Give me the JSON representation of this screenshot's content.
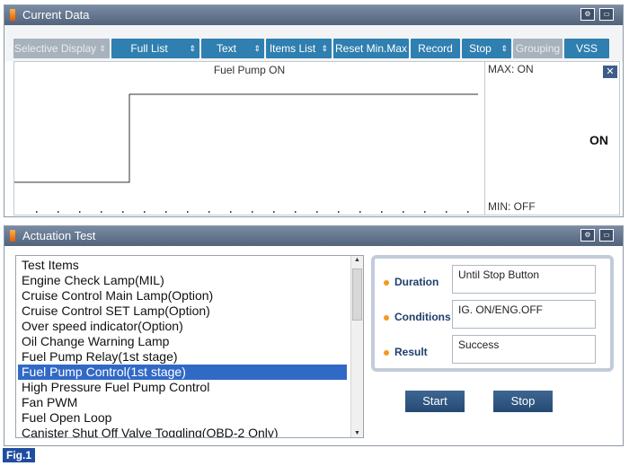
{
  "current_data": {
    "title": "Current Data",
    "toolbar": {
      "selective_display": "Selective Display",
      "full_list": "Full List",
      "text": "Text",
      "items_list": "Items List",
      "reset_min_max": "Reset Min.Max",
      "record": "Record",
      "stop": "Stop",
      "grouping": "Grouping",
      "vss": "VSS"
    },
    "graph": {
      "title": "Fuel Pump ON",
      "max_label": "MAX: ON",
      "min_label": "MIN: OFF",
      "current_value": "ON",
      "step_fraction": 0.245
    }
  },
  "actuation_test": {
    "title": "Actuation Test",
    "list_header": "Test Items",
    "items": [
      "Engine Check Lamp(MIL)",
      "Cruise Control Main Lamp(Option)",
      "Cruise Control SET Lamp(Option)",
      "Over speed indicator(Option)",
      "Oil Change Warning Lamp",
      "Fuel Pump Relay(1st stage)",
      "Fuel Pump Control(1st stage)",
      "High Pressure Fuel Pump Control",
      "Fan PWM",
      "Fuel Open Loop",
      "Canister Shut Off Valve Toggling(OBD-2 Only)"
    ],
    "selected_index": 6,
    "duration_label": "Duration",
    "duration_value": "Until Stop Button",
    "conditions_label": "Conditions",
    "conditions_value": "IG. ON/ENG.OFF",
    "result_label": "Result",
    "result_value": "Success",
    "start_label": "Start",
    "stop_label": "Stop"
  },
  "figure_label": "Fig.1",
  "colors": {
    "accent": "#2f7fb0",
    "selection": "#3169c6",
    "title_bar": "#5f718b"
  }
}
